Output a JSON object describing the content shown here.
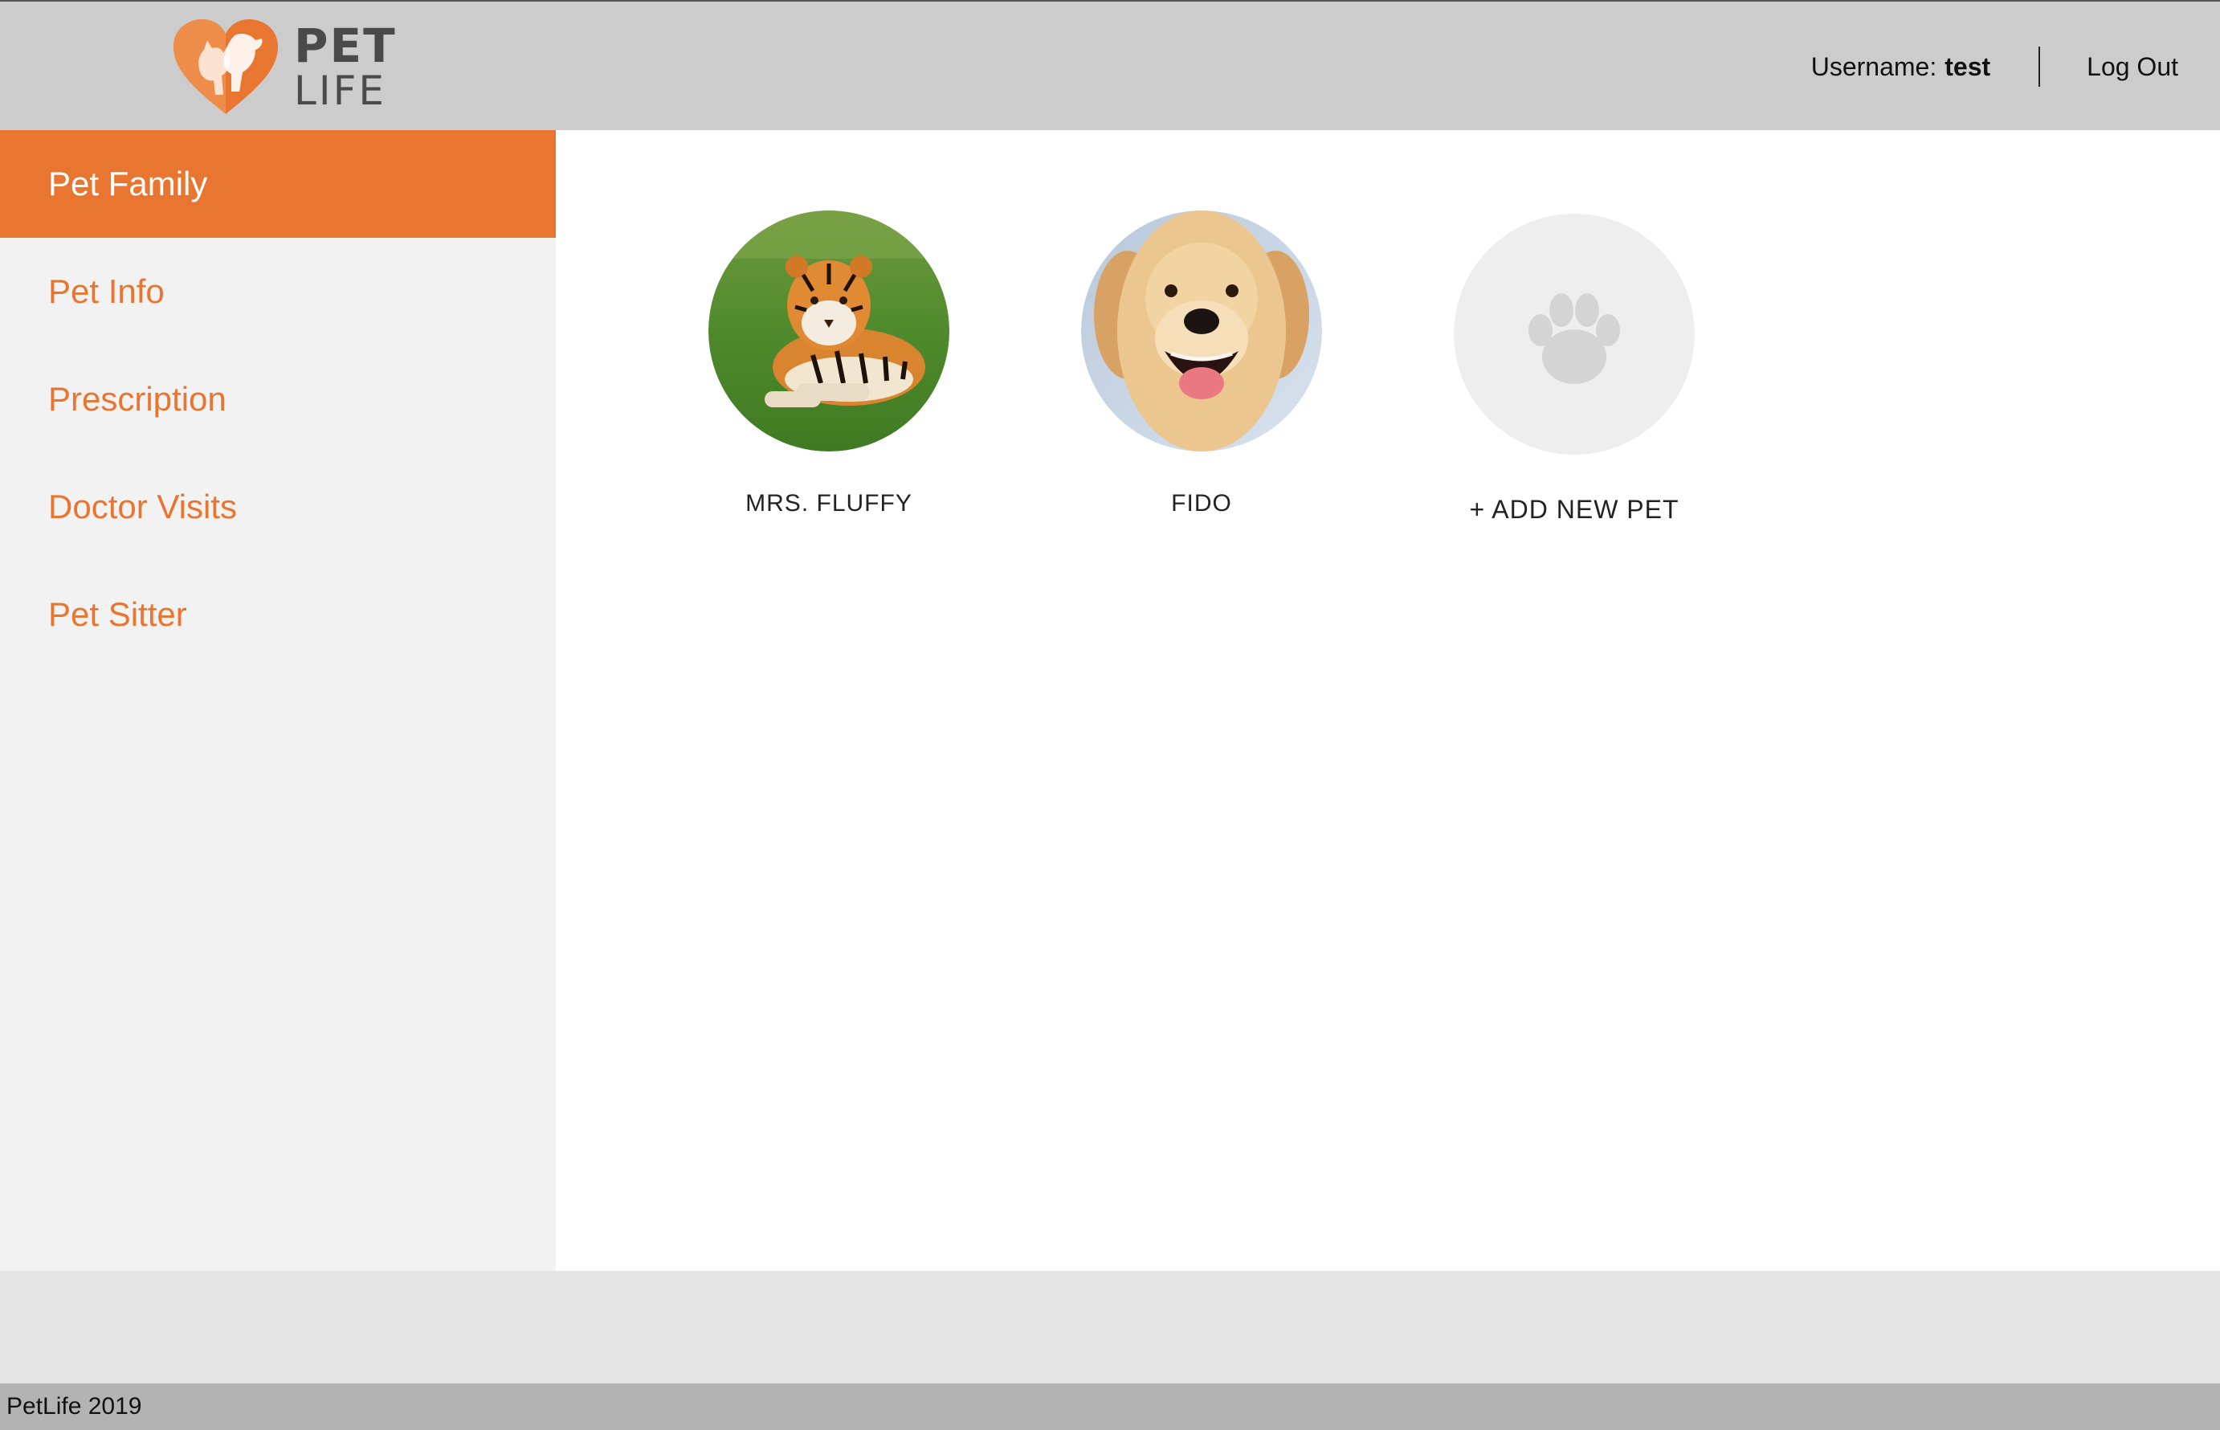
{
  "brand": {
    "line1": "PET",
    "line2": "LIFE",
    "accent_color": "#e87530"
  },
  "header": {
    "username_label": "Username:",
    "username_value": "test",
    "logout_label": "Log Out"
  },
  "sidebar": {
    "items": [
      {
        "label": "Pet Family",
        "active": true
      },
      {
        "label": "Pet Info",
        "active": false
      },
      {
        "label": "Prescription",
        "active": false
      },
      {
        "label": "Doctor Visits",
        "active": false
      },
      {
        "label": "Pet Sitter",
        "active": false
      }
    ]
  },
  "pets": [
    {
      "name": "MRS. FLUFFY",
      "photo": "tiger-photo"
    },
    {
      "name": "FIDO",
      "photo": "golden-retriever-photo"
    }
  ],
  "add_pet": {
    "label": "+ ADD NEW PET",
    "icon": "paw-icon"
  },
  "footer": {
    "text": "PetLife 2019"
  }
}
